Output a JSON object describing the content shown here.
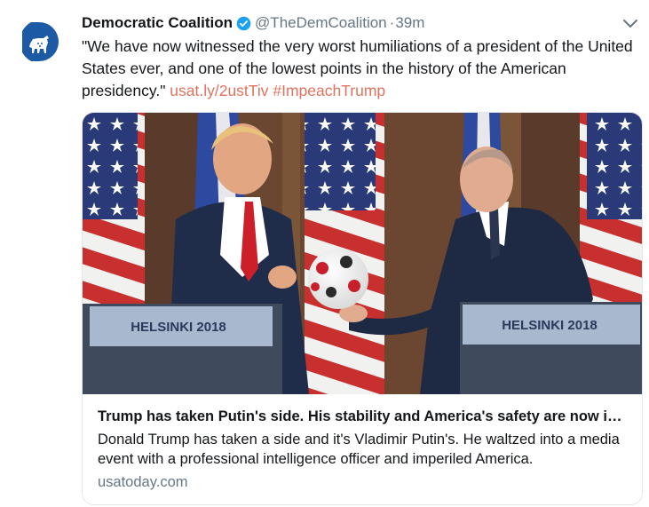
{
  "tweet": {
    "author_name": "Democratic Coalition",
    "handle": "@TheDemCoalition",
    "separator": "·",
    "time": "39m",
    "text_plain": "\"We have now witnessed the very worst humiliations of a president of the United States ever, and one of the lowest points in the history of the American presidency.\" ",
    "link_text": "usat.ly/2ustTiv",
    "hashtag": "#ImpeachTrump"
  },
  "card": {
    "podium_left_text": "HELSINKI 2018",
    "podium_right_text": "HELSINKI 2018",
    "title": "Trump has taken Putin's side. His stability and America's safety are now in question",
    "description": "Donald Trump has taken a side and it's Vladimir Putin's. He waltzed into a media event with a professional intelligence officer and imperiled America.",
    "domain": "usatoday.com"
  },
  "icons": {
    "avatar": "democratic-donkey-logo",
    "verified": "verified-badge-icon",
    "menu": "chevron-down-icon"
  },
  "colors": {
    "accent": "#1da1f2",
    "link": "#e0735e",
    "logo_blue": "#1c5aa5",
    "muted": "#657786"
  }
}
